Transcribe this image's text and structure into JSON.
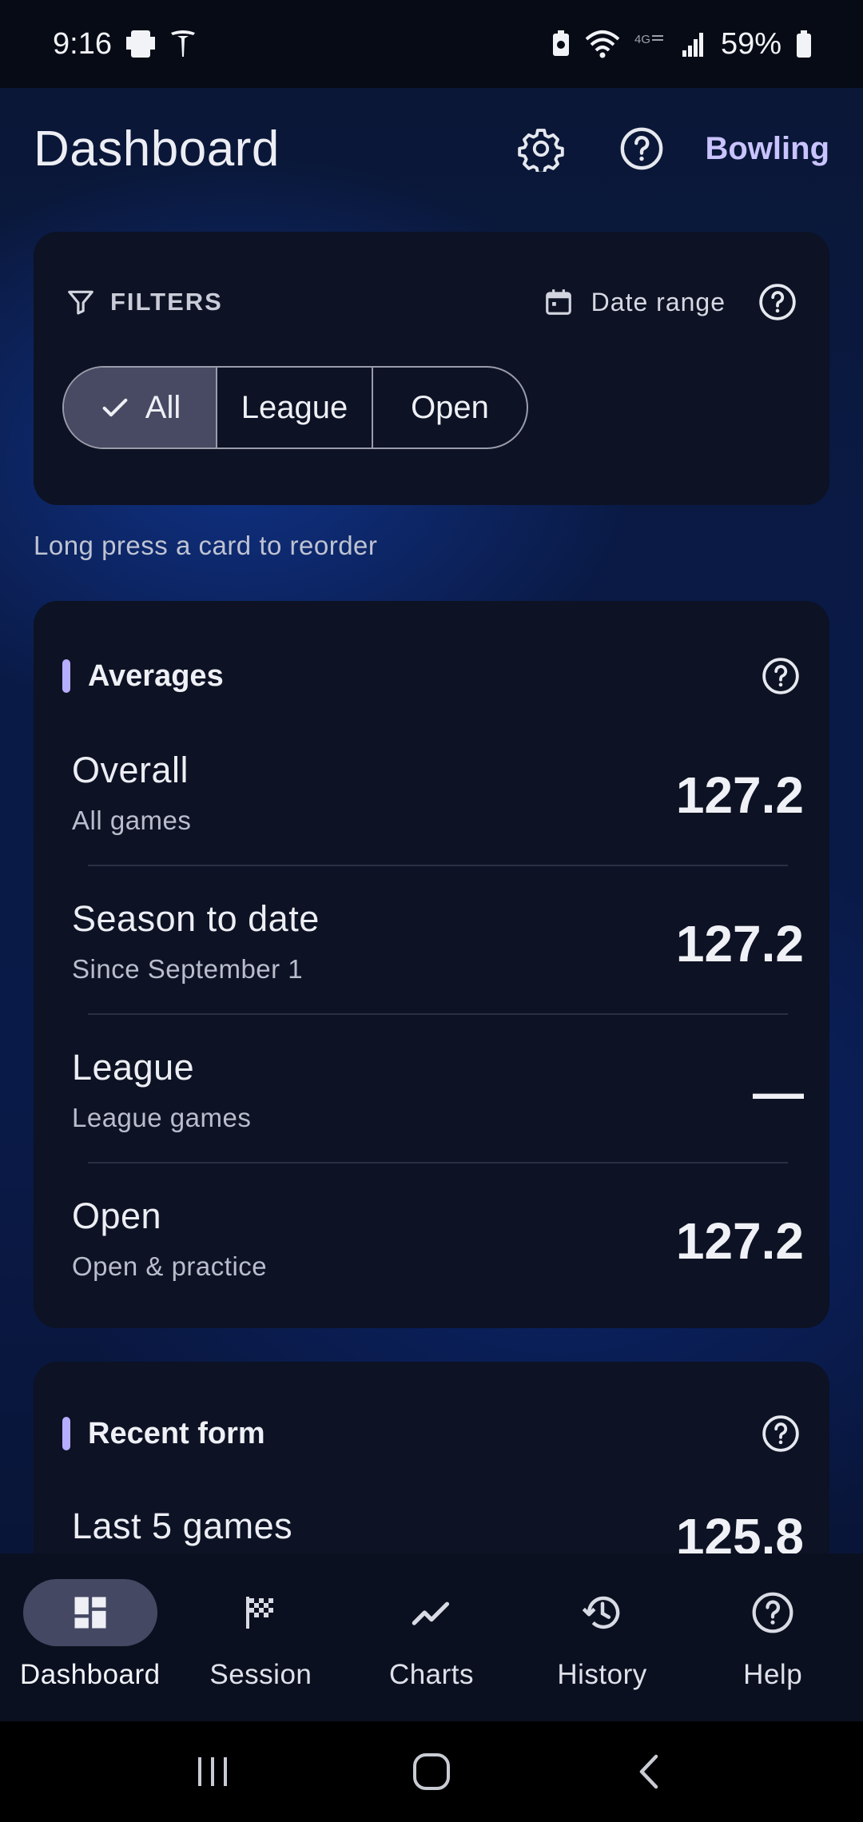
{
  "status_bar": {
    "time": "9:16",
    "battery": "59%"
  },
  "app_bar": {
    "title": "Dashboard",
    "brand": "Bowling"
  },
  "filters": {
    "label": "FILTERS",
    "date_range": "Date range",
    "segments": [
      {
        "label": "All",
        "selected": true
      },
      {
        "label": "League",
        "selected": false
      },
      {
        "label": "Open",
        "selected": false
      }
    ]
  },
  "hint": "Long press a card to reorder",
  "averages": {
    "title": "Averages",
    "rows": [
      {
        "label": "Overall",
        "sub": "All games",
        "value": "127.2"
      },
      {
        "label": "Season to date",
        "sub": "Since September 1",
        "value": "127.2"
      },
      {
        "label": "League",
        "sub": "League games",
        "value": "—"
      },
      {
        "label": "Open",
        "sub": "Open & practice",
        "value": "127.2"
      }
    ]
  },
  "recent_form": {
    "title": "Recent form",
    "rows": [
      {
        "label": "Last 5 games",
        "value": "125.8"
      }
    ]
  },
  "bottom_nav": {
    "items": [
      {
        "label": "Dashboard",
        "icon": "dashboard-icon",
        "active": true
      },
      {
        "label": "Session",
        "icon": "checkered-flag-icon",
        "active": false
      },
      {
        "label": "Charts",
        "icon": "trend-line-icon",
        "active": false
      },
      {
        "label": "History",
        "icon": "history-icon",
        "active": false
      },
      {
        "label": "Help",
        "icon": "help-icon",
        "active": false
      }
    ]
  },
  "colors": {
    "accent": "#b7adff",
    "brand": "#c9c3ff",
    "card": "#0d1224",
    "selected_segment": "#474a62"
  }
}
